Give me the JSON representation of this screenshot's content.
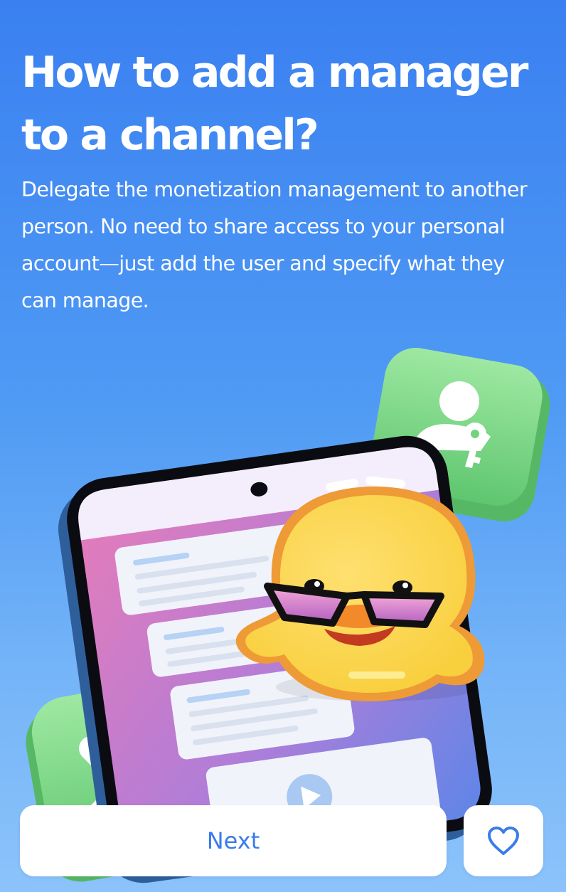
{
  "onboarding": {
    "title": "How to add a manager to a channel?",
    "description": "Delegate the monetization management to another person. No need to share access to your personal account—just add the user and specify what they can manage."
  },
  "illustration": {
    "icons": [
      "smartphone-icon",
      "user-key-icon",
      "close-x-icon",
      "duck-sticker",
      "play-icon"
    ]
  },
  "actions": {
    "next_label": "Next",
    "like_icon": "heart-outline-icon"
  },
  "colors": {
    "background_top": "#3a80f1",
    "background_bottom": "#8cc3fa",
    "accent": "#3a7cea",
    "badge_green": "#72d37f"
  }
}
